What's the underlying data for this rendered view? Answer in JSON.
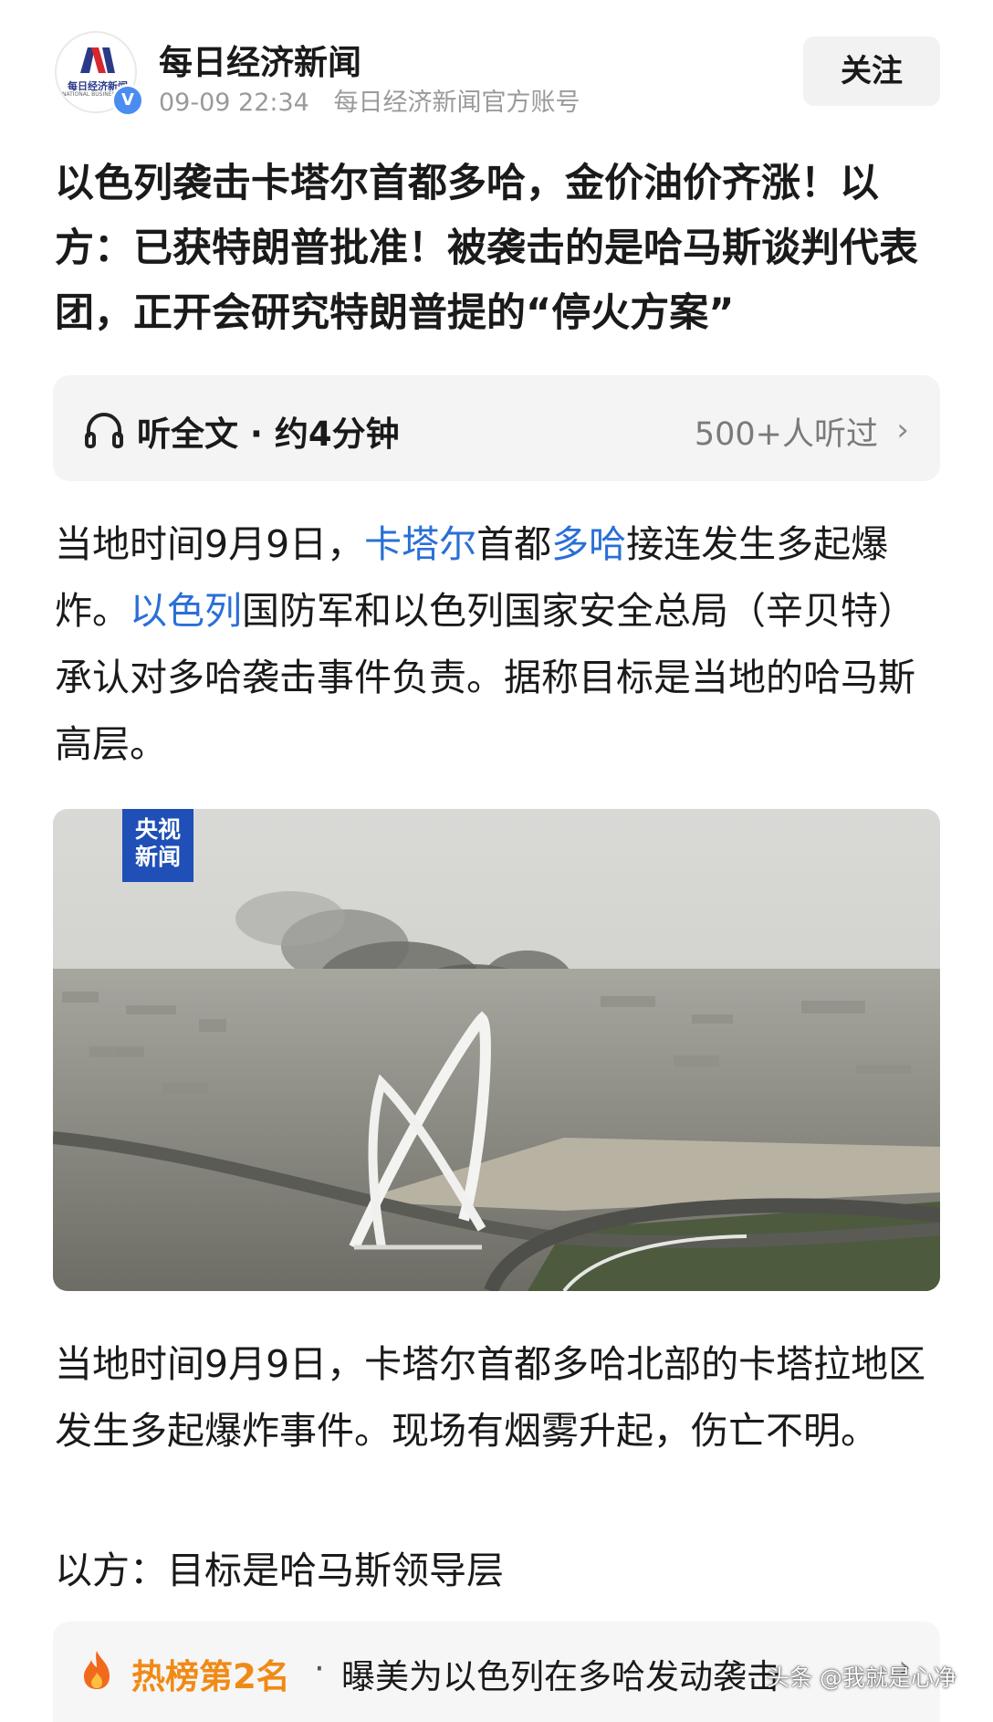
{
  "header": {
    "author": "每日经济新闻",
    "avatar_text": "每日经济新闻",
    "avatar_subtext": "NATIONAL BUSINESS DAILY",
    "verified_badge": "V",
    "time": "09-09 22:34",
    "account_desc": "每日经济新闻官方账号",
    "follow_label": "关注"
  },
  "article": {
    "title": "以色列袭击卡塔尔首都多哈，金价油价齐涨！以方：已获特朗普批准！被袭击的是哈马斯谈判代表团，正开会研究特朗普提的“停火方案”",
    "listen": {
      "label": "听全文 · 约4分钟",
      "count": "500+人听过",
      "chevron": "›"
    },
    "para1": {
      "s1": "当地时间9月9日，",
      "link1": "卡塔尔",
      "s2": "首都",
      "link2": "多哈",
      "s3": "接连发生多起爆炸。",
      "link3": "以色列",
      "s4": "国防军和以色列国家安全总局（辛贝特）承认对多哈袭击事件负责。据称目标是当地的哈马斯高层。"
    },
    "image": {
      "logo_line1": "央视",
      "logo_line2": "新闻"
    },
    "para2": "当地时间9月9日，卡塔尔首都多哈北部的卡塔拉地区发生多起爆炸事件。现场有烟雾升起，伤亡不明。",
    "para3": "以方：目标是哈马斯领导层"
  },
  "hot": {
    "rank": "热榜第2名",
    "dot": "·",
    "text": "曝美为以色列在多哈发动袭击",
    "chevron": "›"
  },
  "watermark": "头条 @我就是心净",
  "colors": {
    "link": "#2a6fd6",
    "hot_rank": "#f08a16",
    "cctv_blue": "#1f4fb7",
    "verified": "#4a8cf0"
  },
  "icons": [
    "headphones-icon",
    "chevron-right-icon",
    "flame-icon",
    "verified-icon"
  ]
}
